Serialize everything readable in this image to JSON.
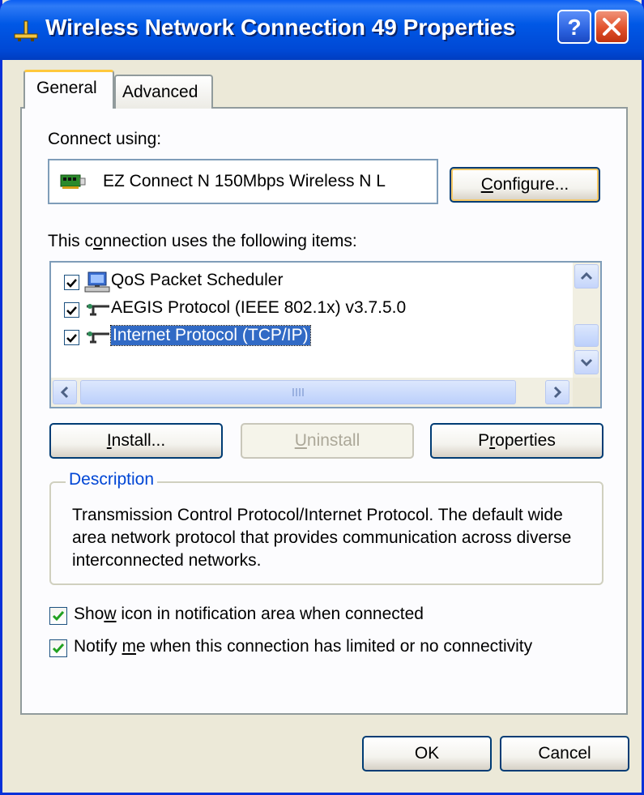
{
  "window": {
    "title": "Wireless Network Connection 49 Properties",
    "colors": {
      "title_bar": "#0058e6",
      "selection": "#316ac5",
      "group_title": "#0046d5",
      "check_green": "#21a121"
    }
  },
  "tabs": [
    {
      "label": "General",
      "active": true
    },
    {
      "label": "Advanced",
      "active": false
    }
  ],
  "general": {
    "connect_using_label": "Connect using:",
    "adapter_name": "EZ Connect N 150Mbps Wireless N L",
    "configure_button": {
      "pre": "",
      "key": "C",
      "post": "onfigure..."
    },
    "items_label": {
      "pre": "This c",
      "key": "o",
      "post": "nnection uses the following items:"
    },
    "items": [
      {
        "label": "QoS Packet Scheduler",
        "checked": true,
        "icon": "network-scheduler-icon",
        "selected": false
      },
      {
        "label": "AEGIS Protocol (IEEE 802.1x) v3.7.5.0",
        "checked": true,
        "icon": "protocol-icon",
        "selected": false
      },
      {
        "label": "Internet Protocol (TCP/IP)",
        "checked": true,
        "icon": "protocol-icon",
        "selected": true
      }
    ],
    "install_button": {
      "pre": "",
      "key": "I",
      "post": "nstall..."
    },
    "uninstall_button": {
      "pre": "",
      "key": "U",
      "post": "ninstall",
      "enabled": false
    },
    "properties_button": {
      "pre": "P",
      "key": "r",
      "post": "operties"
    },
    "description_title": "Description",
    "description_text": "Transmission Control Protocol/Internet Protocol. The default wide area network protocol that provides communication across diverse interconnected networks.",
    "show_icon": {
      "pre": "Sho",
      "key": "w",
      "post": " icon in notification area when connected",
      "checked": true
    },
    "notify": {
      "pre": "Notify ",
      "key": "m",
      "post": "e when this connection has limited or no connectivity",
      "checked": true
    }
  },
  "footer": {
    "ok_label": "OK",
    "cancel_label": "Cancel"
  }
}
